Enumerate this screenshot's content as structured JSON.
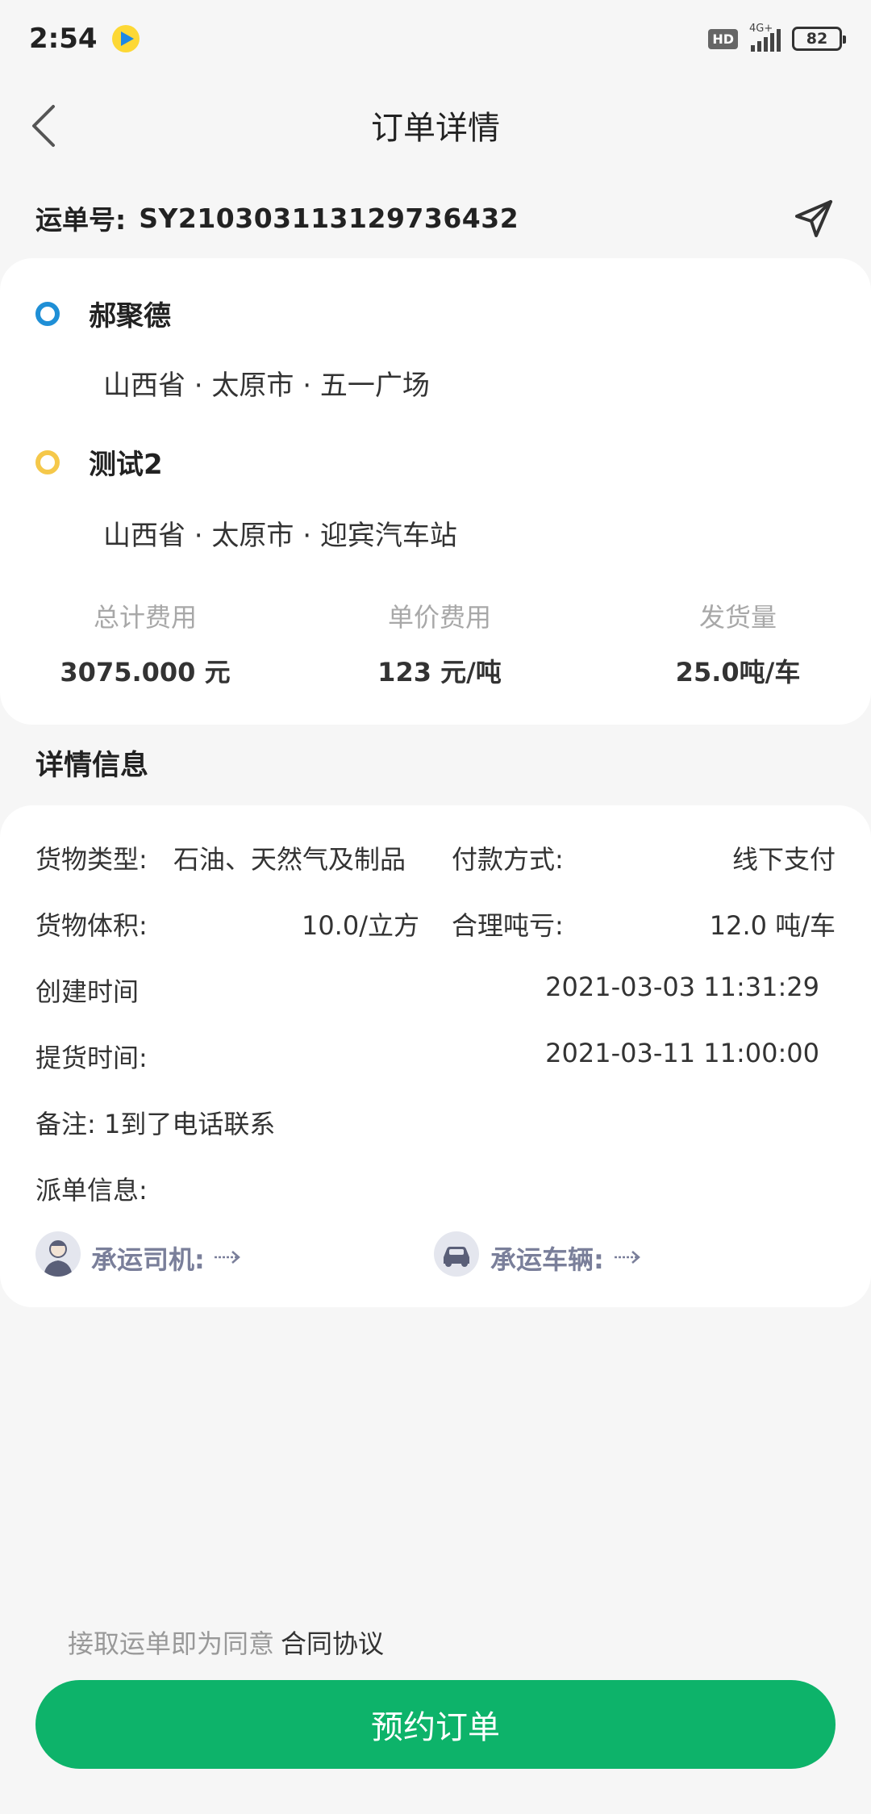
{
  "status_bar": {
    "time": "2:54",
    "hd": "HD",
    "network": "4G+",
    "battery": "82"
  },
  "header": {
    "title": "订单详情"
  },
  "waybill": {
    "label": "运单号:",
    "number": "SY210303113129736432"
  },
  "route": {
    "origin": {
      "name": "郝聚德",
      "address": "山西省 · 太原市 · 五一广场"
    },
    "destination": {
      "name": "测试2",
      "address": "山西省 · 太原市 · 迎宾汽车站"
    }
  },
  "fees": [
    {
      "label": "总计费用",
      "value": "3075.000 元"
    },
    {
      "label": "单价费用",
      "value": "123 元/吨"
    },
    {
      "label": "发货量",
      "value": "25.0吨/车"
    }
  ],
  "details": {
    "section_title": "详情信息",
    "cargo_type_label": "货物类型:",
    "cargo_type_value": "石油、天然气及制品",
    "payment_label": "付款方式:",
    "payment_value": "线下支付",
    "volume_label": "货物体积:",
    "volume_value": "10.0/立方",
    "loss_label": "合理吨亏:",
    "loss_value": "12.0 吨/车",
    "created_label": "创建时间",
    "created_value": "2021-03-03 11:31:29",
    "pickup_label": "提货时间:",
    "pickup_value": "2021-03-11 11:00:00",
    "remark": "备注: 1到了电话联系",
    "dispatch_label": "派单信息:",
    "driver_label": "承运司机:",
    "vehicle_label": "承运车辆:"
  },
  "footer": {
    "agreement_prefix": "接取运单即为同意",
    "agreement_link": "合同协议",
    "button_label": "预约订单"
  },
  "colors": {
    "primary": "#0db36a",
    "origin_dot": "#1f8fd6",
    "destination_dot": "#f5c84a",
    "muted": "#a8a8a8"
  }
}
